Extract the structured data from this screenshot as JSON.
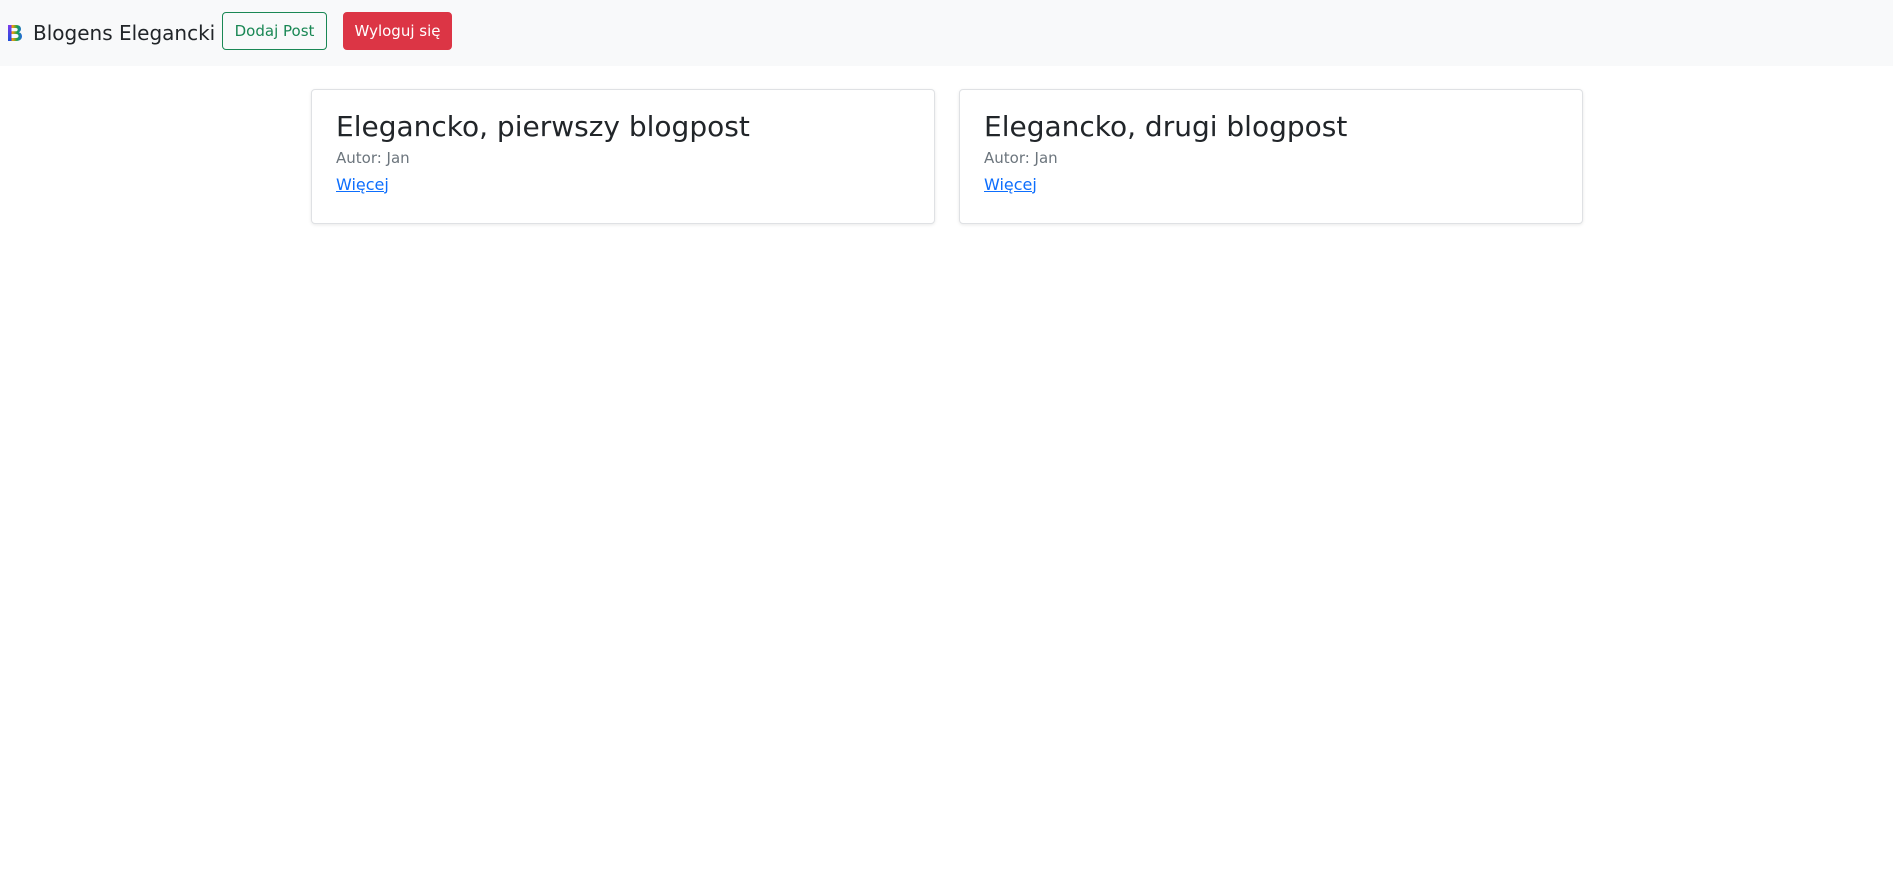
{
  "navbar": {
    "brand_text": "Blogens Elegancki",
    "add_post_label": "Dodaj Post",
    "logout_label": "Wyloguj się",
    "logo_icon": "bootstrap-b-icon"
  },
  "colors": {
    "navbar_bg": "#f8f9fa",
    "success": "#198754",
    "danger": "#dc3545",
    "link": "#0d6efd",
    "muted": "#6c757d"
  },
  "posts": [
    {
      "title": "Elegancko, pierwszy blogpost",
      "author": "Autor: Jan",
      "more_label": "Więcej"
    },
    {
      "title": "Elegancko, drugi blogpost",
      "author": "Autor: Jan",
      "more_label": "Więcej"
    }
  ]
}
